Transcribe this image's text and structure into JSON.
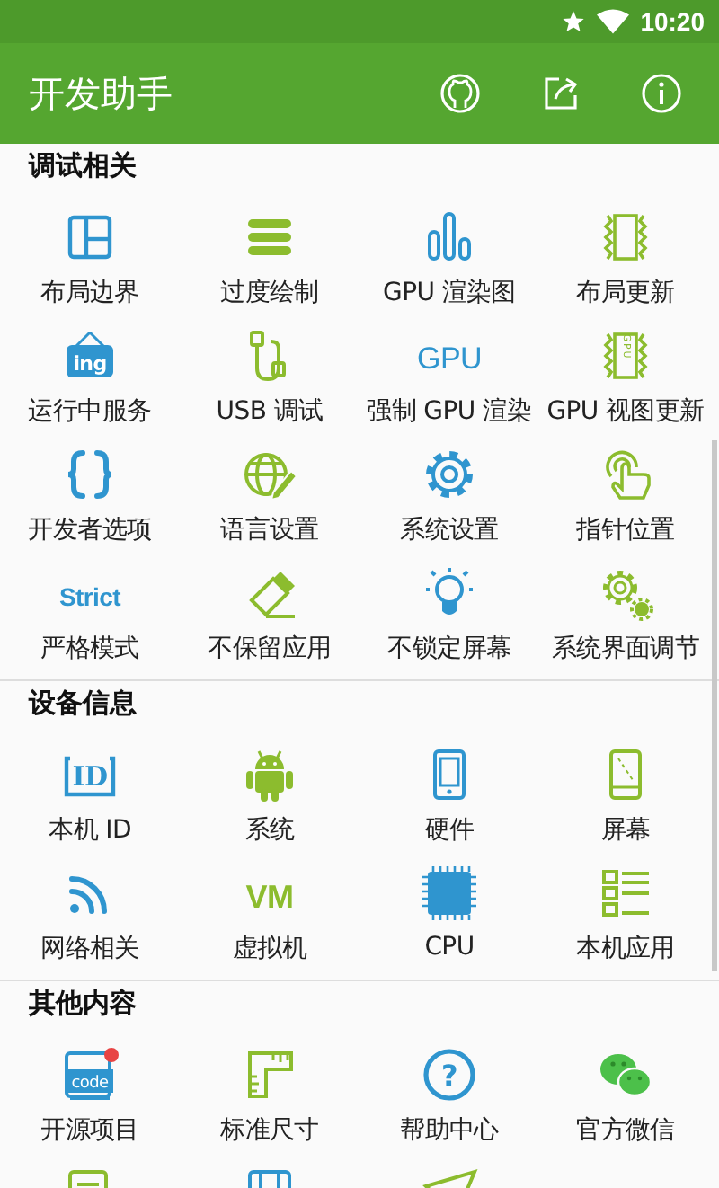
{
  "status_bar": {
    "time": "10:20"
  },
  "app_bar": {
    "title": "开发助手",
    "actions": [
      {
        "kind": "github"
      },
      {
        "kind": "share"
      },
      {
        "kind": "info"
      }
    ]
  },
  "sections": [
    {
      "title": "调试相关",
      "items": [
        {
          "kind": "layout",
          "label": "布局边界"
        },
        {
          "kind": "lines",
          "label": "过度绘制"
        },
        {
          "kind": "bars",
          "label": "GPU 渲染图"
        },
        {
          "kind": "zigzag",
          "label": "布局更新"
        },
        {
          "kind": "sign",
          "icon_text": "ing",
          "label": "运行中服务"
        },
        {
          "kind": "cable",
          "label": "USB 调试"
        },
        {
          "kind": "wordmark-blue",
          "icon_text": "GPU",
          "label": "强制 GPU 渲染"
        },
        {
          "kind": "zigzag-text",
          "icon_text": "GPU",
          "label": "GPU 视图更新"
        },
        {
          "kind": "braces",
          "label": "开发者选项"
        },
        {
          "kind": "globe",
          "label": "语言设置"
        },
        {
          "kind": "gear",
          "label": "系统设置"
        },
        {
          "kind": "touch",
          "label": "指针位置"
        },
        {
          "kind": "wordmark-blue",
          "icon_text": "Strict",
          "label": "严格模式"
        },
        {
          "kind": "eraser",
          "label": "不保留应用"
        },
        {
          "kind": "bulb",
          "label": "不锁定屏幕"
        },
        {
          "kind": "gears",
          "label": "系统界面调节"
        }
      ]
    },
    {
      "title": "设备信息",
      "items": [
        {
          "kind": "id-card",
          "icon_text": "ID",
          "label": "本机 ID"
        },
        {
          "kind": "android",
          "label": "系统"
        },
        {
          "kind": "phone",
          "label": "硬件"
        },
        {
          "kind": "screen",
          "label": "屏幕"
        },
        {
          "kind": "wifi",
          "label": "网络相关"
        },
        {
          "kind": "wordmark-green",
          "icon_text": "VM",
          "label": "虚拟机"
        },
        {
          "kind": "chip",
          "label": "CPU"
        },
        {
          "kind": "list",
          "label": "本机应用"
        }
      ]
    },
    {
      "title": "其他内容",
      "items": [
        {
          "kind": "code-box",
          "icon_text": "code",
          "label": "开源项目"
        },
        {
          "kind": "ruler",
          "label": "标准尺寸"
        },
        {
          "kind": "question",
          "icon_text": "?",
          "label": "帮助中心"
        },
        {
          "kind": "chat",
          "label": "官方微信"
        },
        {
          "kind": "note"
        },
        {
          "kind": "frame"
        },
        {
          "kind": "plane"
        }
      ]
    }
  ]
}
